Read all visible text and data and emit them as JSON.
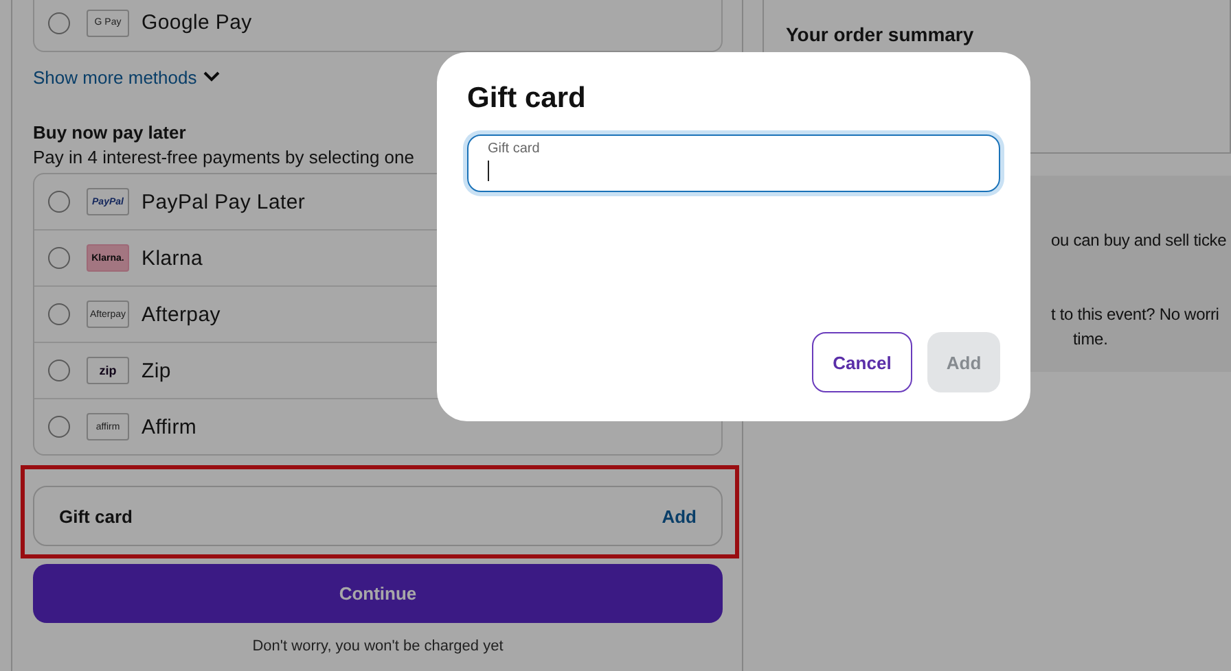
{
  "top_method": {
    "name": "Google Pay",
    "logo": "G Pay",
    "selected": false
  },
  "show_more": {
    "label": "Show more methods"
  },
  "bnpl": {
    "title": "Buy now pay later",
    "subtitle": "Pay in 4 interest-free payments by selecting one",
    "methods": [
      {
        "name": "PayPal Pay Later",
        "logo": "PayPal",
        "selected": false
      },
      {
        "name": "Klarna",
        "logo": "Klarna.",
        "selected": false
      },
      {
        "name": "Afterpay",
        "logo": "Afterpay",
        "selected": false
      },
      {
        "name": "Zip",
        "logo": "zip",
        "selected": false
      },
      {
        "name": "Affirm",
        "logo": "affirm",
        "selected": false
      }
    ]
  },
  "gift_card_row": {
    "label": "Gift card",
    "action": "Add"
  },
  "continue_button": "Continue",
  "footer_note": "Don't worry, you won't be charged yet",
  "order_summary": {
    "title": "Your order summary",
    "info_lines": [
      "ou can buy and sell ticke",
      "t to this event? No worri",
      "time."
    ]
  },
  "dialog": {
    "title": "Gift card",
    "field": {
      "label": "Gift card"
    },
    "buttons": [
      {
        "label": "Cancel",
        "disabled": false
      },
      {
        "label": "Add",
        "disabled": true
      }
    ]
  }
}
